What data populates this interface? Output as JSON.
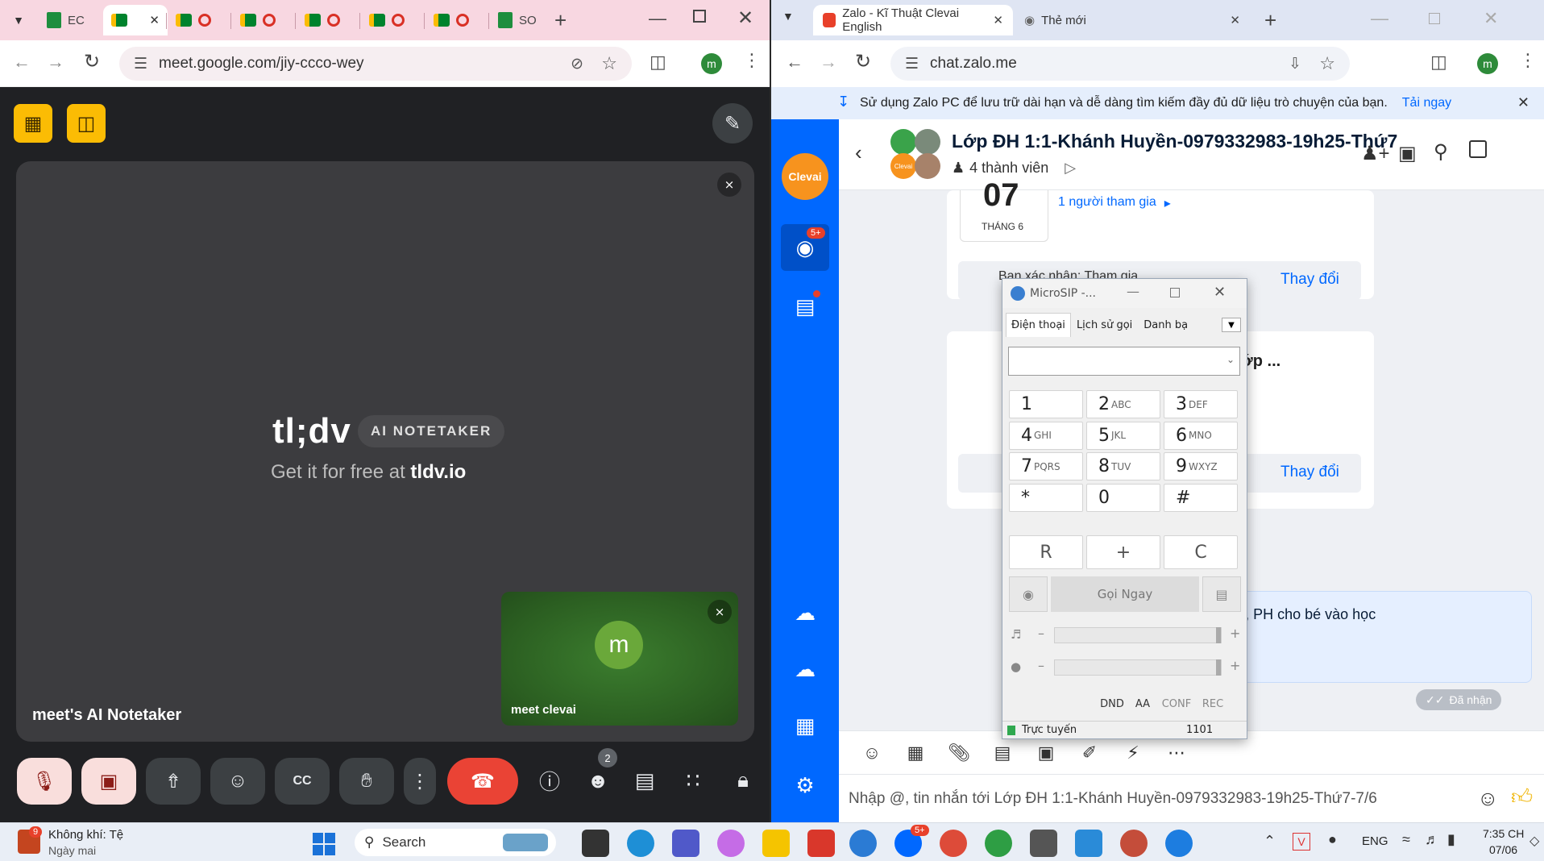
{
  "left_browser": {
    "tabs": [
      {
        "label": "EC",
        "icon": "sheets-icon"
      },
      {
        "label": "",
        "icon": "meet-icon"
      },
      {
        "label": "",
        "icon": "meet-icon"
      },
      {
        "label": "",
        "icon": "meet-icon"
      },
      {
        "label": "",
        "icon": "meet-icon"
      },
      {
        "label": "",
        "icon": "meet-icon"
      },
      {
        "label": "",
        "icon": "meet-icon"
      },
      {
        "label": "SO",
        "icon": "sheets-icon"
      }
    ],
    "url": "meet.google.com/jiy-ccco-wey",
    "profile_initial": "m"
  },
  "meet": {
    "tldv_logo": "tl;dv",
    "tldv_badge": "AI NOTETAKER",
    "tldv_sub_prefix": "Get it for free at",
    "tldv_sub_link": "tldv.io",
    "main_participant": "meet's AI Notetaker",
    "self_name": "meet clevai",
    "self_initial": "m",
    "participants_count": "2",
    "colors": {
      "end_call": "#ea4335",
      "muted_bg": "#f9dedc",
      "self_tile": "#2b5e21"
    }
  },
  "right_browser": {
    "tabs": [
      {
        "label": "Zalo - Kĩ Thuật Clevai English",
        "badge": "5+"
      },
      {
        "label": "Thẻ mới"
      }
    ],
    "url": "chat.zalo.me",
    "profile_initial": "m",
    "banner_text": "Sử dụng Zalo PC để lưu trữ dài hạn và dễ dàng tìm kiếm đầy đủ dữ liệu trò chuyện của bạn.",
    "banner_link": "Tải ngay"
  },
  "zalo": {
    "brand": "Clevai",
    "chat_badge": "5+",
    "group_avatar_label": "Clevai",
    "group_title": "Lớp ĐH 1:1-Khánh Huyền-0979332983-19h25-Thứ7",
    "member_count": "4 thành viên",
    "event_day": "07",
    "event_month": "THÁNG 6",
    "event_join": "1 người tham gia",
    "confirm_text": "Bạn xác nhận: Tham gia",
    "change_label": "Thay đổi",
    "partial_title": "tin lớp ...",
    "message_partial": "Anh lúc 19h25, PH cho bé vào học",
    "received": "Đã nhận",
    "input_placeholder": "Nhập @, tin nhắn tới Lớp ĐH 1:1-Khánh Huyền-0979332983-19h25-Thứ7-7/6",
    "accent": "#0068ff"
  },
  "microsip": {
    "title": "MicroSIP -...",
    "tabs": [
      "Điện thoại",
      "Lịch sử gọi",
      "Danh bạ"
    ],
    "keys": [
      {
        "digit": "1",
        "letters": ""
      },
      {
        "digit": "2",
        "letters": "ABC"
      },
      {
        "digit": "3",
        "letters": "DEF"
      },
      {
        "digit": "4",
        "letters": "GHI"
      },
      {
        "digit": "5",
        "letters": "JKL"
      },
      {
        "digit": "6",
        "letters": "MNO"
      },
      {
        "digit": "7",
        "letters": "PQRS"
      },
      {
        "digit": "8",
        "letters": "TUV"
      },
      {
        "digit": "9",
        "letters": "WXYZ"
      },
      {
        "digit": "*",
        "letters": ""
      },
      {
        "digit": "0",
        "letters": ""
      },
      {
        "digit": "#",
        "letters": ""
      }
    ],
    "func_keys": [
      "R",
      "+",
      "C"
    ],
    "call_button": "Gọi Ngay",
    "small_buttons": [
      "DND",
      "AA",
      "CONF",
      "REC"
    ],
    "status": "Trực tuyến",
    "extension": "1101",
    "volume_level": 1.0,
    "mic_level": 1.0
  },
  "taskbar": {
    "weather_title": "Không khí: Tệ",
    "weather_sub": "Ngày mai",
    "weather_badge": "9",
    "search_label": "Search",
    "zalo_badge": "5+",
    "language": "ENG",
    "time": "7:35 CH",
    "date": "07/06"
  }
}
